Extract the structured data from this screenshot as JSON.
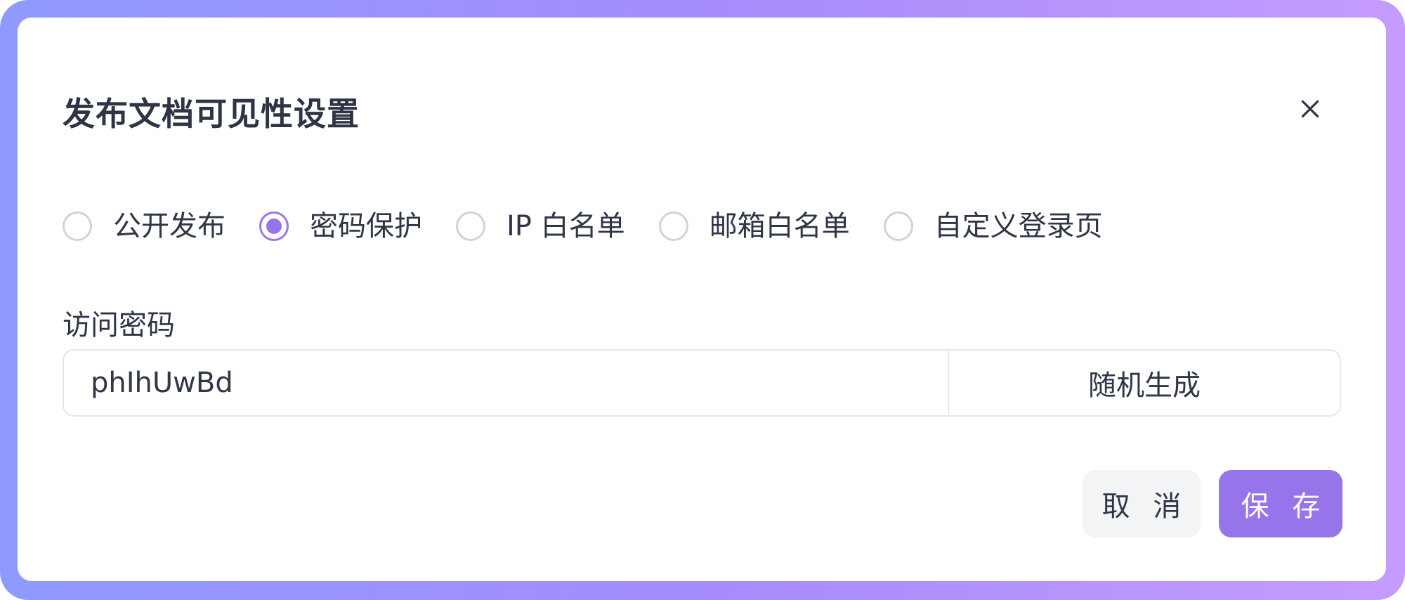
{
  "dialog": {
    "title": "发布文档可见性设置",
    "close_icon": "close-icon"
  },
  "visibility_options": [
    {
      "label": "公开发布",
      "checked": false
    },
    {
      "label": "密码保护",
      "checked": true
    },
    {
      "label": "IP 白名单",
      "checked": false
    },
    {
      "label": "邮箱白名单",
      "checked": false
    },
    {
      "label": "自定义登录页",
      "checked": false
    }
  ],
  "password": {
    "label": "访问密码",
    "value": "phIhUwBd",
    "generate_label": "随机生成"
  },
  "footer": {
    "cancel_label": "取 消",
    "save_label": "保 存"
  },
  "colors": {
    "accent": "#9674ea",
    "frame_gradient_start": "#8f9afc",
    "frame_gradient_end": "#c59cfd",
    "text": "#2f3645",
    "cancel_bg": "#f3f4f6"
  }
}
